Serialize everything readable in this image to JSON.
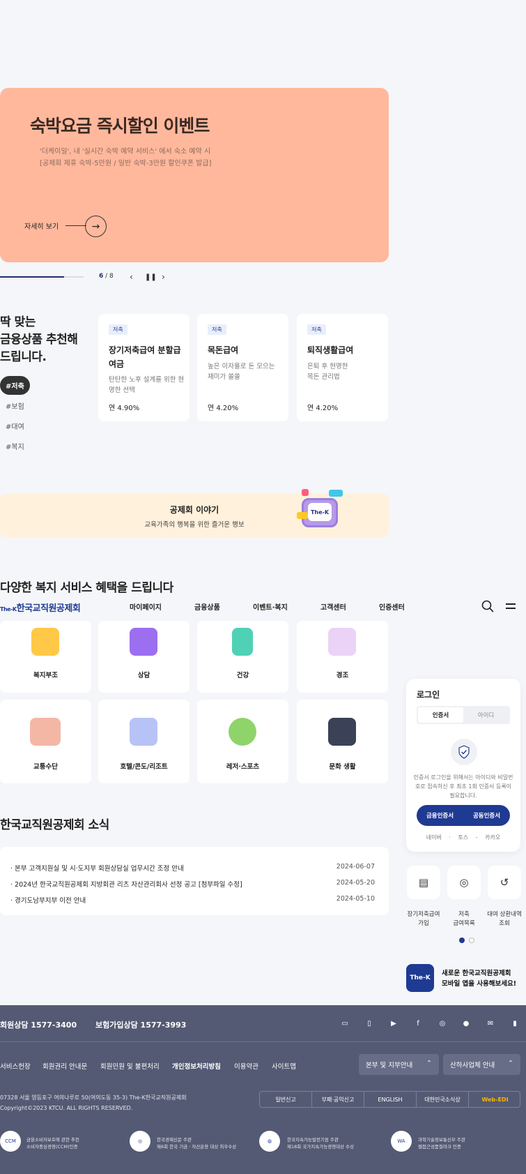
{
  "hero": {
    "title": "숙박요금 즉시할인 이벤트",
    "desc1": "'더케이일', 내 '실시간 숙박 예약 서비스' 에서 숙소 예약 시",
    "desc2": "[공제회 제휴 숙박-5만원 / 일반 숙박-3만원 할인쿠폰 발급]",
    "more": "자세히 보기"
  },
  "slider": {
    "current": "6",
    "total": "/ 8",
    "progress": 0.77
  },
  "recommend": {
    "title_line1": "딱 맞는",
    "title_line2": "금융상품 추천해",
    "title_line3": "드립니다.",
    "tags": [
      "#저축",
      "#보험",
      "#대여",
      "#복지"
    ],
    "products": [
      {
        "badge": "저축",
        "name": "장기저축급여 분할급여금",
        "desc": "탄탄한 노후 설계를 위한 현명한 선택",
        "rate": "연 4.90%"
      },
      {
        "badge": "저축",
        "name": "목돈급여",
        "desc": "높은 이자율로 돈 모으는 재미가 쏠쏠",
        "rate": "연 4.20%"
      },
      {
        "badge": "저축",
        "name": "퇴직생활급여",
        "desc": "은퇴 후 현명한 목돈 관리법",
        "rate": "연 4.20%"
      }
    ]
  },
  "story": {
    "title": "공제회 이야기",
    "sub": "교육가족의 행복을 위한 즐거운 행보",
    "tv_label": "The-K"
  },
  "welfare": {
    "title": "다양한 복지 서비스 혜택을 드립니다",
    "items": [
      "복지부조",
      "상담",
      "건강",
      "경조",
      "교통수단",
      "호텔/콘도/리조트",
      "레저·스포츠",
      "문화 생활"
    ]
  },
  "header": {
    "logo_prefix": "The-K",
    "logo": "한국교직원공제회",
    "nav": [
      "마이페이지",
      "금융상품",
      "이벤트·복지",
      "고객센터",
      "인증센터"
    ]
  },
  "login": {
    "title": "로그인",
    "tabs": [
      "인증서",
      "아이디"
    ],
    "desc": "인증서 로그인을 위해서는 아이디와 비밀번호로 접속하신 후 최초 1회 인증서 등록이 필요합니다.",
    "btn_financial": "금융인증서",
    "btn_public": "공동인증서",
    "social": [
      "네이버",
      "토스",
      "카카오"
    ]
  },
  "quick": [
    {
      "l1": "장기저축급여",
      "l2": "가입"
    },
    {
      "l1": "저축",
      "l2": "급여목록"
    },
    {
      "l1": "대여 상환내역",
      "l2": "조회"
    }
  ],
  "app": {
    "logo": "The-K",
    "line1": "새로운 한국교직원공제회",
    "line2": "모바일 앱을 사용해보세요!"
  },
  "news": {
    "title": "한국교직원공제회 소식",
    "rows": [
      {
        "text": "본부 고객지원실 및 시·도지부 회원상담실 업무시간 조정 안내",
        "date": "2024-06-07"
      },
      {
        "text": "2024년 한국교직원공제회 지방회관 리츠 자산관리회사 선정 공고 [첨부파일 수정]",
        "date": "2024-05-20"
      },
      {
        "text": "경기도남부지부 이전 안내",
        "date": "2024-05-10"
      }
    ]
  },
  "footer": {
    "phone1": "회원상담 1577-3400",
    "phone2": "보험가입상담 1577-3993",
    "links": [
      "서비스헌장",
      "회원권리 안내문",
      "회원민원 및 불편처리",
      "개인정보처리방침",
      "이용약관",
      "사이트맵"
    ],
    "select1": "본부 및 지부안내",
    "select2": "산하사업체 안내",
    "addr1": "07328 서울 영등포구 여의나루로 50(여의도동 35-3) The-K한국교직원공제회",
    "addr2": "Copyright©2023 KTCU. ALL RIGHTS RESERVED.",
    "buttons": [
      "일반신고",
      "부패·공익신고",
      "ENGLISH",
      "대한민국소식상",
      "Web-EDI"
    ],
    "awards": [
      {
        "l1": "금융소비자보호에 관한 추천",
        "l2": "소비자중심경영(CCM)인증"
      },
      {
        "l1": "한국경제신문 주관",
        "l2": "제6회 한국 기금 · 자산운용 대상 최우수상"
      },
      {
        "l1": "한국지속가능발전기원 주관",
        "l2": "제18회 국가지속가능경영대상 수상"
      },
      {
        "l1": "과학기술정보통신부 주관",
        "l2": "웹접근성품질마크 인증"
      }
    ],
    "accent": "#ffb400"
  }
}
